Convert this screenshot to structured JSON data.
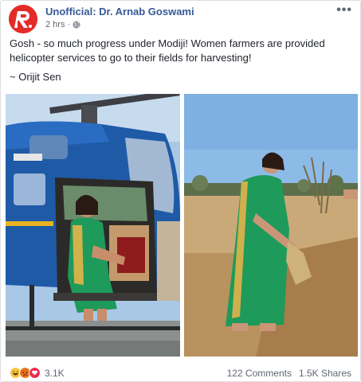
{
  "post": {
    "page_name": "Unofficial: Dr. Arnab Goswami",
    "timestamp": "2 hrs",
    "privacy_separator": "·",
    "more_options": "•••",
    "body_text": "Gosh - so much progress under Modiji! Women farmers are provided helicopter services to go to their fields for harvesting!",
    "attribution": "~ Orijit Sen",
    "avatar_letter": "R."
  },
  "footer": {
    "reaction_icons": [
      "haha-icon",
      "angry-icon",
      "love-icon"
    ],
    "reaction_count": "3.1K",
    "comments": "122 Comments",
    "shares": "1.5K Shares"
  },
  "colors": {
    "link_blue": "#365899",
    "avatar_red": "#e32b27",
    "meta_gray": "#616770",
    "helicopter_blue": "#1f5aa6",
    "saree_green": "#1e9a5a"
  }
}
